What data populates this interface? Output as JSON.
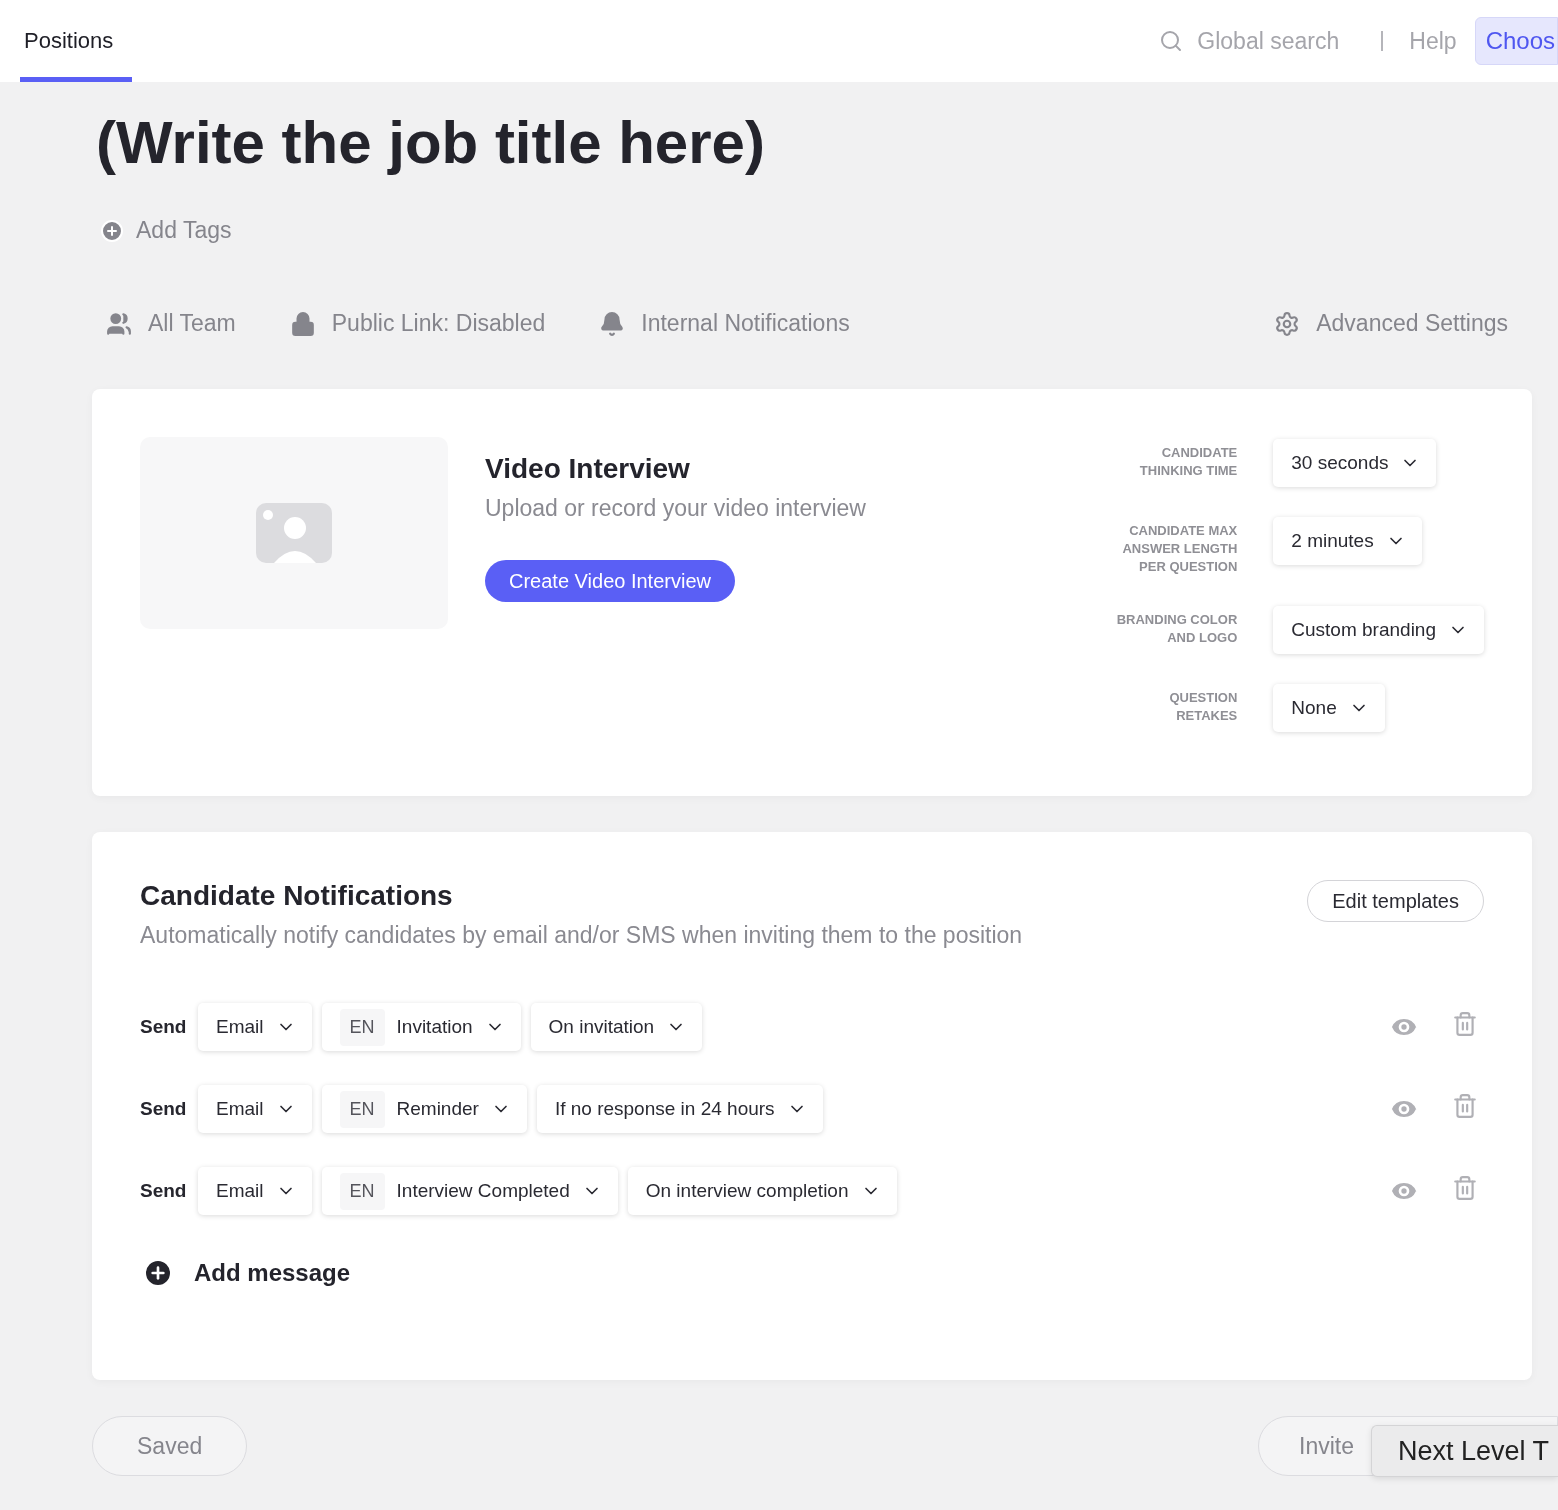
{
  "top_bar": {
    "tabs": [
      {
        "label": "Positions",
        "selected": true
      }
    ],
    "search": {
      "placeholder": "Global search"
    },
    "help": "Help",
    "choose_button": "Choos"
  },
  "job_title": "(Write the job title here)",
  "add_tags": "Add Tags",
  "settings_bar": [
    {
      "kind": "team",
      "label": "All Team"
    },
    {
      "kind": "lock",
      "label": "Public Link: Disabled"
    },
    {
      "kind": "bell",
      "label": "Internal Notifications"
    },
    {
      "kind": "gear",
      "label": "Advanced Settings"
    }
  ],
  "video_card": {
    "title": "Video Interview",
    "subtitle": "Upload or record your video interview",
    "button": "Create Video Interview",
    "options": [
      {
        "label": "CANDIDATE THINKING TIME",
        "value": "30 seconds"
      },
      {
        "label": "CANDIDATE MAX ANSWER LENGTH PER QUESTION",
        "value": "2 minutes"
      },
      {
        "label": "BRANDING COLOR AND LOGO",
        "value": "Custom branding"
      },
      {
        "label": "QUESTION RETAKES",
        "value": "None"
      }
    ]
  },
  "notifications": {
    "title": "Candidate Notifications",
    "subtitle": "Automatically notify candidates by email and/or SMS when inviting them to the position",
    "edit_button": "Edit templates",
    "rows": [
      {
        "send": "Send",
        "channel": "Email",
        "lang": "EN",
        "template": "Invitation",
        "trigger": "On invitation"
      },
      {
        "send": "Send",
        "channel": "Email",
        "lang": "EN",
        "template": "Reminder",
        "trigger": "If no response in 24 hours"
      },
      {
        "send": "Send",
        "channel": "Email",
        "lang": "EN",
        "template": "Interview Completed",
        "trigger": "On interview completion"
      }
    ],
    "add_message": "Add message"
  },
  "footer": {
    "saved": "Saved",
    "invite": "Invite",
    "tooltip": "Next Level T"
  }
}
